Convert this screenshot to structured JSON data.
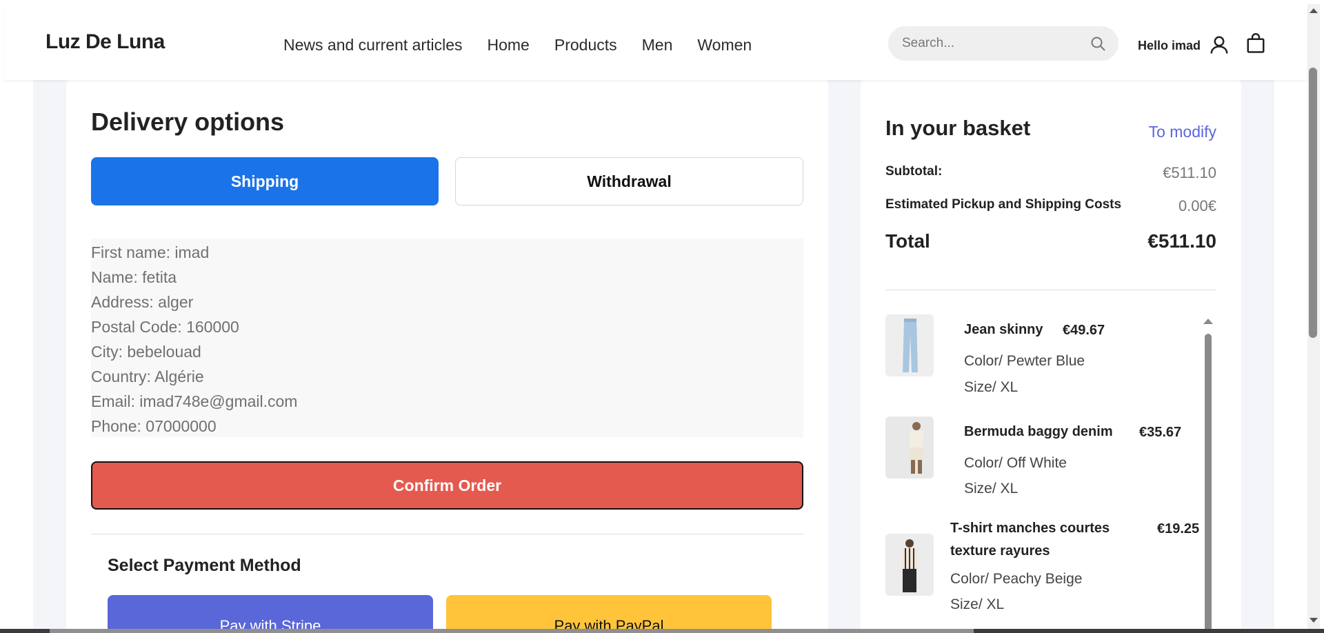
{
  "header": {
    "logo": "Luz De Luna",
    "nav": [
      "News and current articles",
      "Home",
      "Products",
      "Men",
      "Women"
    ],
    "search_placeholder": "Search...",
    "greeting": "Hello imad"
  },
  "delivery": {
    "title": "Delivery options",
    "tab_shipping": "Shipping",
    "tab_withdrawal": "Withdrawal",
    "address_lines": [
      "First name: imad",
      "Name: fetita",
      "Address: alger",
      "Postal Code: 160000",
      "City: bebelouad",
      "Country: Algérie",
      "Email: imad748e@gmail.com",
      "Phone: 07000000"
    ],
    "confirm_label": "Confirm Order",
    "payment_title": "Select Payment Method",
    "pay_stripe": "Pay with Stripe",
    "pay_paypal": "Pay with PayPal"
  },
  "basket": {
    "title": "In your basket",
    "modify": "To modify",
    "subtotal_label": "Subtotal:",
    "subtotal_value": "€511.10",
    "shipping_label": "Estimated Pickup and Shipping Costs",
    "shipping_value": "0.00€",
    "total_label": "Total",
    "total_value": "€511.10",
    "items": [
      {
        "name": "Jean skinny",
        "price": "€49.67",
        "color": "Color/ Pewter Blue",
        "size": "Size/ XL"
      },
      {
        "name": "Bermuda baggy denim",
        "price": "€35.67",
        "color": "Color/ Off White",
        "size": "Size/ XL"
      },
      {
        "name_line1": "T-shirt manches courtes",
        "name_line2": "texture rayures",
        "price": "€19.25",
        "color": "Color/ Peachy Beige",
        "size": "Size/ XL"
      }
    ]
  },
  "colors": {
    "shipping_tab": "#1a73e8",
    "confirm": "#e45a4f",
    "stripe": "#5a67d8",
    "paypal": "#ffc439",
    "link": "#5a67d8"
  }
}
